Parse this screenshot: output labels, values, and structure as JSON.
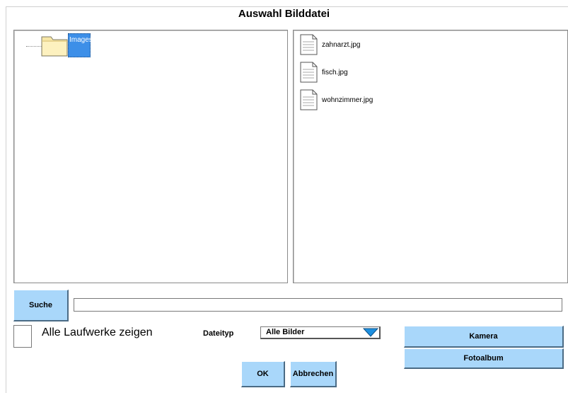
{
  "dialog": {
    "title": "Auswahl Bilddatei"
  },
  "tree": {
    "root_label": "Images"
  },
  "files": [
    {
      "name": "zahnarzt.jpg"
    },
    {
      "name": "fisch.jpg"
    },
    {
      "name": "wohnzimmer.jpg"
    }
  ],
  "search": {
    "button_label": "Suche",
    "value": ""
  },
  "options": {
    "show_all_drives_label": "Alle Laufwerke zeigen",
    "show_all_drives_checked": false,
    "filetype_label": "Dateityp",
    "filetype_value": "Alle Bilder"
  },
  "buttons": {
    "camera": "Kamera",
    "photo_album": "Fotoalbum",
    "ok": "OK",
    "cancel": "Abbrechen"
  },
  "colors": {
    "button_fill": "#a9d7fa",
    "selection": "#3d8fe8",
    "dropdown_arrow": "#1e90e0"
  }
}
